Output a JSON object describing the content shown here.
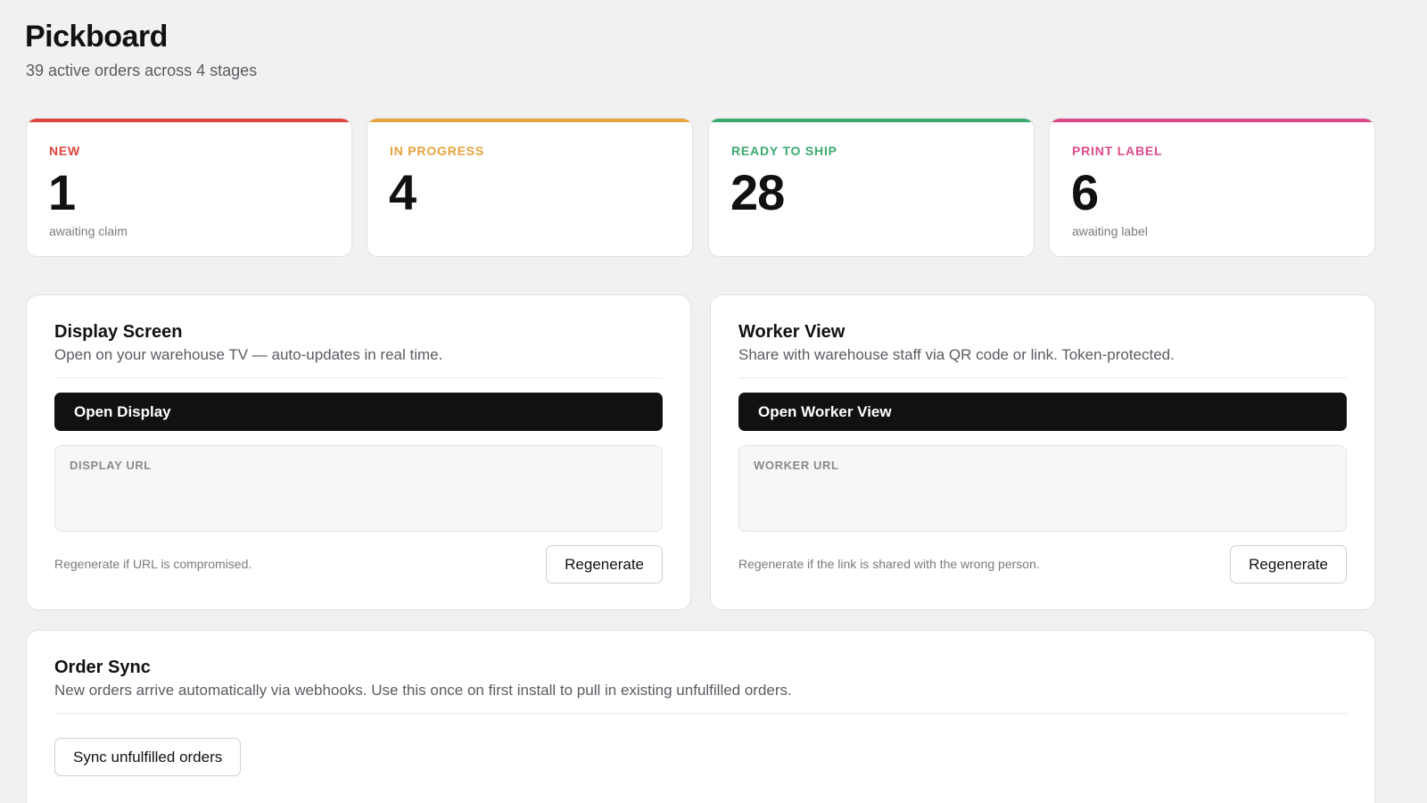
{
  "header": {
    "title": "Pickboard",
    "subtitle": "39 active orders across 4 stages"
  },
  "stats": [
    {
      "label": "NEW",
      "value": "1",
      "note": "awaiting claim",
      "color": "#e0443e"
    },
    {
      "label": "IN PROGRESS",
      "value": "4",
      "note": "",
      "color": "#e8a23a"
    },
    {
      "label": "READY TO SHIP",
      "value": "28",
      "note": "",
      "color": "#3aaa6e"
    },
    {
      "label": "PRINT LABEL",
      "value": "6",
      "note": "awaiting label",
      "color": "#dd4a8a"
    }
  ],
  "display_panel": {
    "title": "Display Screen",
    "description": "Open on your warehouse TV — auto-updates in real time.",
    "open_button": "Open Display",
    "url_label": "DISPLAY URL",
    "url_value": "",
    "footnote": "Regenerate if URL is compromised.",
    "regenerate_button": "Regenerate"
  },
  "worker_panel": {
    "title": "Worker View",
    "description": "Share with warehouse staff via QR code or link. Token-protected.",
    "open_button": "Open Worker View",
    "url_label": "WORKER URL",
    "url_value": "",
    "footnote": "Regenerate if the link is shared with the wrong person.",
    "regenerate_button": "Regenerate"
  },
  "sync_panel": {
    "title": "Order Sync",
    "description": "New orders arrive automatically via webhooks. Use this once on first install to pull in existing unfulfilled orders.",
    "sync_button": "Sync unfulfilled orders"
  }
}
